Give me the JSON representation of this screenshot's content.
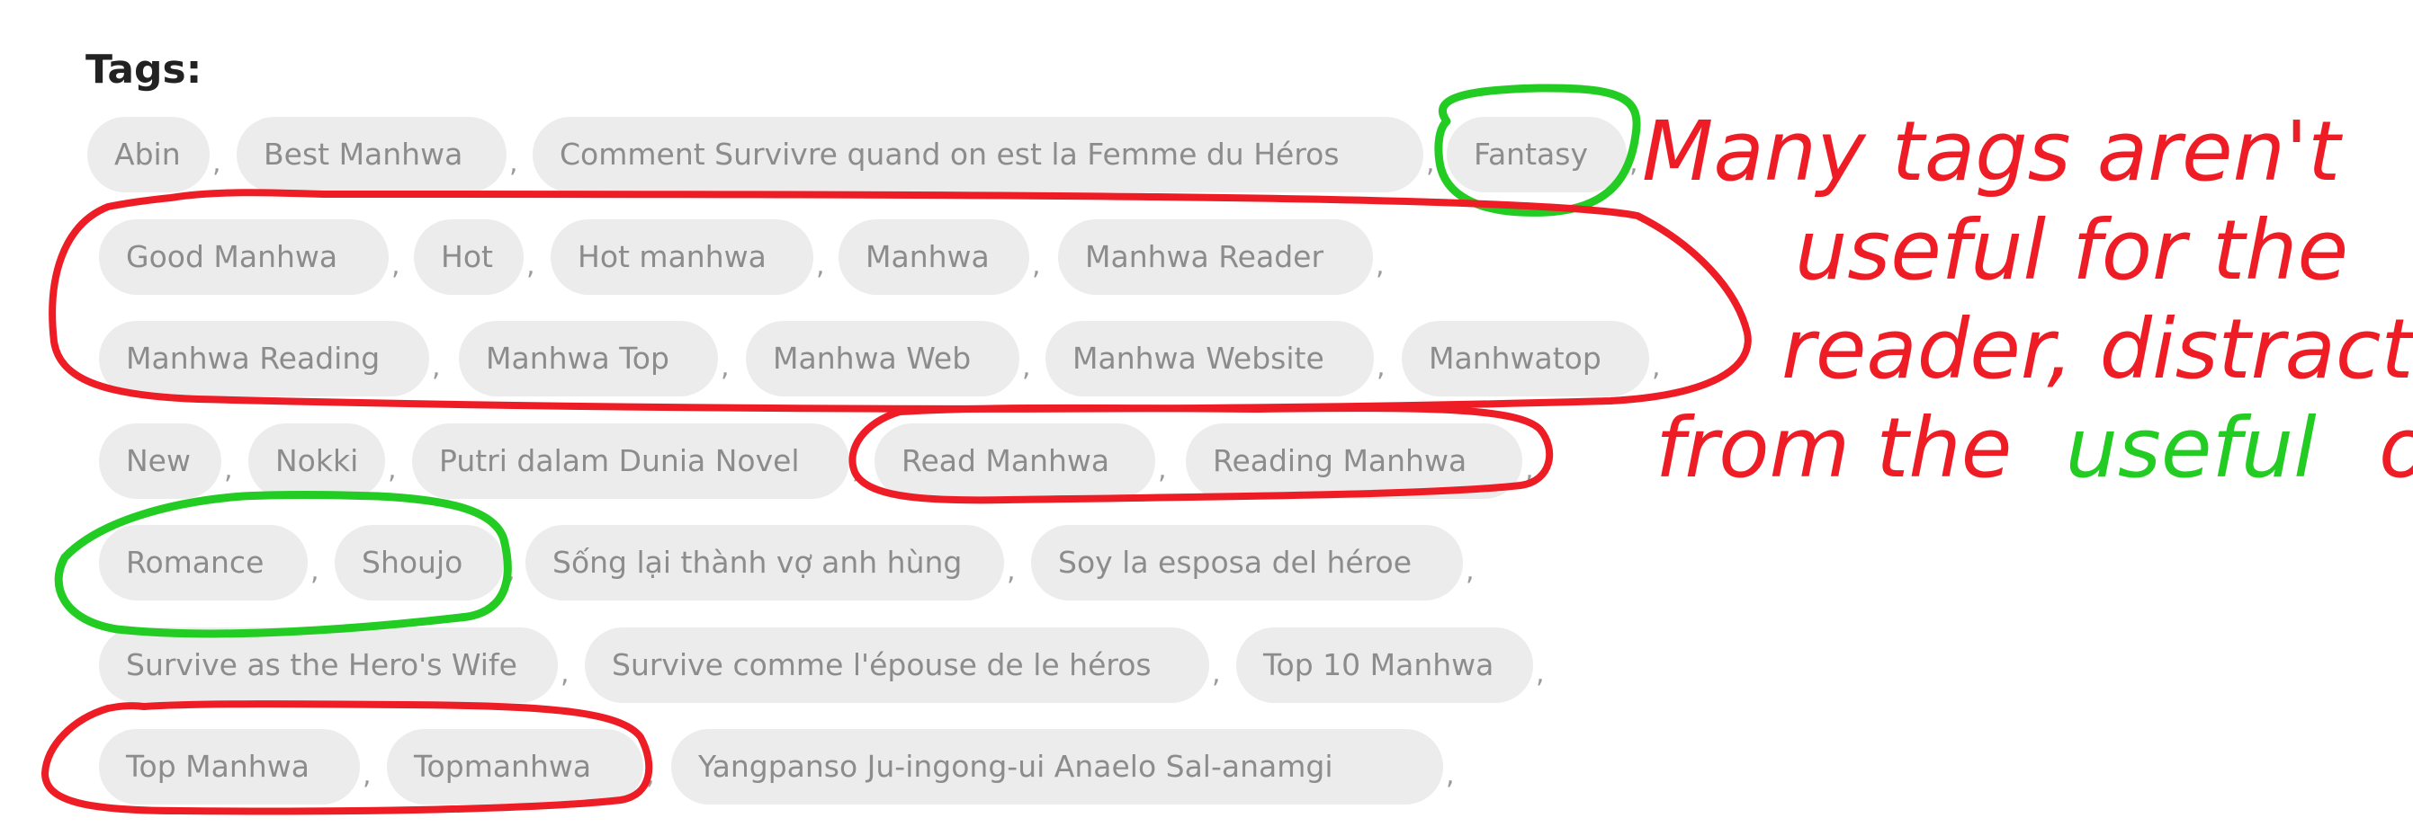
{
  "heading": "Tags:",
  "separator": ",",
  "tags": [
    "Abin",
    "Best Manhwa",
    "Comment Survivre quand on est la Femme du Héros",
    "Fantasy",
    "Good Manhwa",
    "Hot",
    "Hot manhwa",
    "Manhwa",
    "Manhwa Reader",
    "Manhwa Reading",
    "Manhwa Top",
    "Manhwa Web",
    "Manhwa Website",
    "Manhwatop",
    "New",
    "Nokki",
    "Putri dalam Dunia Novel",
    "Read Manhwa",
    "Reading Manhwa",
    "Romance",
    "Shoujo",
    "Sống lại thành vợ anh hùng",
    "Soy la esposa del héroe",
    "Survive as the Hero's Wife",
    "Survive comme l'épouse de le héros",
    "Top 10 Manhwa",
    "Top Manhwa",
    "Topmanhwa",
    "Yangpanso Ju-ingong-ui Anaelo Sal-anamgi"
  ],
  "annotation": {
    "lines": [
      "Many tags aren't",
      "useful for the",
      "reader, distracting"
    ],
    "last_line_start": "from the",
    "last_line_emphasis": "useful",
    "last_line_end": "ones",
    "colors": {
      "red": "#ee1c25",
      "green": "#22cc22"
    }
  },
  "colors": {
    "chip_bg": "#ececec",
    "chip_text": "#8c8c8c",
    "heading": "#222222"
  }
}
